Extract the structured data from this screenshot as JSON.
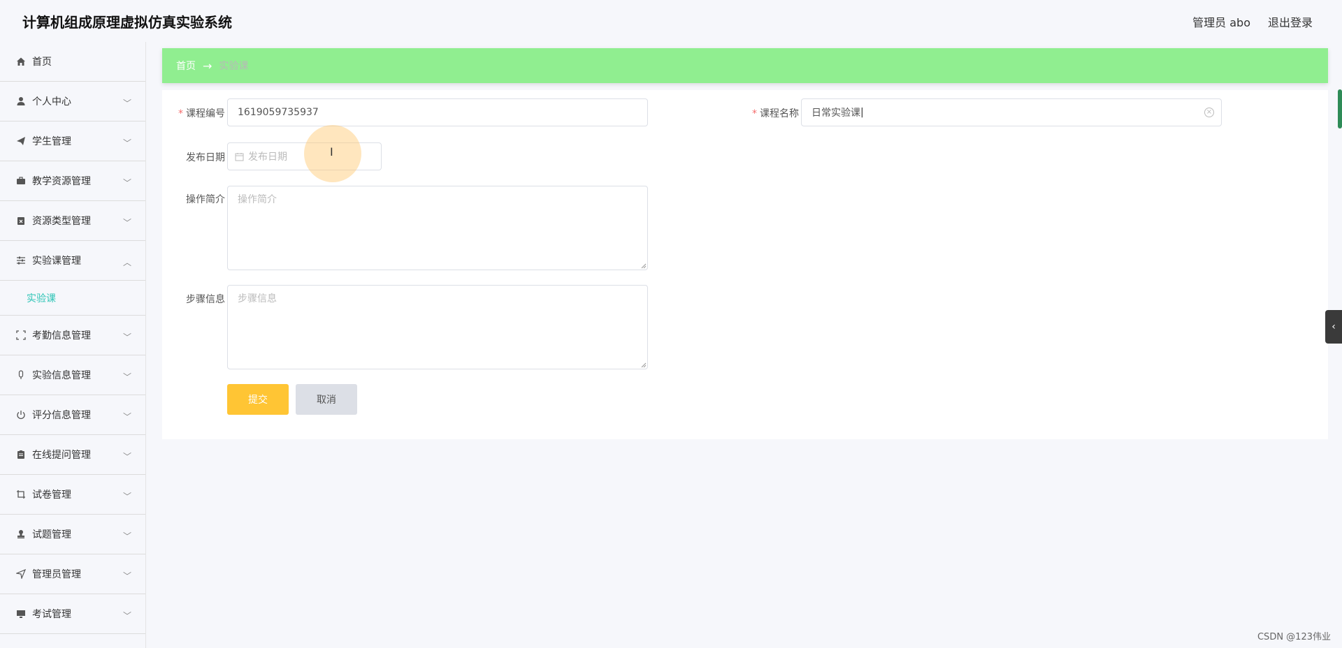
{
  "header": {
    "app_title": "计算机组成原理虚拟仿真实验系统",
    "admin_label": "管理员 abo",
    "logout_label": "退出登录"
  },
  "sidebar": {
    "items": [
      {
        "label": "首页",
        "icon": "home-icon"
      },
      {
        "label": "个人中心",
        "icon": "user-icon"
      },
      {
        "label": "学生管理",
        "icon": "paper-plane-icon"
      },
      {
        "label": "教学资源管理",
        "icon": "briefcase-icon"
      },
      {
        "label": "资源类型管理",
        "icon": "clipboard-x-icon"
      },
      {
        "label": "实验课管理",
        "icon": "sliders-icon"
      },
      {
        "label": "考勤信息管理",
        "icon": "fullscreen-icon"
      },
      {
        "label": "实验信息管理",
        "icon": "microphone-icon"
      },
      {
        "label": "评分信息管理",
        "icon": "power-icon"
      },
      {
        "label": "在线提问管理",
        "icon": "clipboard-icon"
      },
      {
        "label": "试卷管理",
        "icon": "crop-icon"
      },
      {
        "label": "试题管理",
        "icon": "stamp-icon"
      },
      {
        "label": "管理员管理",
        "icon": "navigation-icon"
      },
      {
        "label": "考试管理",
        "icon": "monitor-icon"
      }
    ],
    "expanded_submenu_label": "实验课"
  },
  "breadcrumb": {
    "home": "首页",
    "current": "实验课"
  },
  "form": {
    "course_no_label": "课程编号",
    "course_no_value": "1619059735937",
    "course_name_label": "课程名称",
    "course_name_value": "日常实验课",
    "publish_date_label": "发布日期",
    "publish_date_placeholder": "发布日期",
    "intro_label": "操作简介",
    "intro_placeholder": "操作简介",
    "steps_label": "步骤信息",
    "steps_placeholder": "步骤信息",
    "submit_label": "提交",
    "cancel_label": "取消"
  },
  "watermark": "CSDN @123伟业",
  "colors": {
    "breadcrumb_bg": "#90ee90",
    "submit_bg": "#ffc534",
    "submenu_active": "#2ec4b6",
    "required": "#f56c6c"
  }
}
